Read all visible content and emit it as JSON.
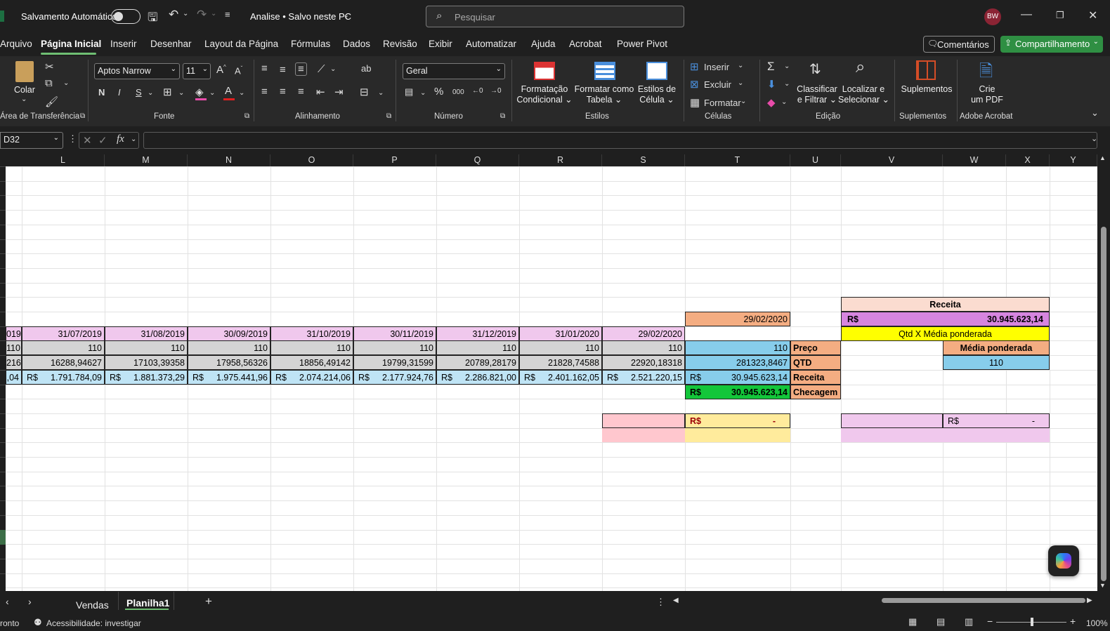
{
  "titlebar": {
    "autosave": "Salvamento Automático",
    "filename": "Analise • Salvo neste PC",
    "search_placeholder": "Pesquisar",
    "avatar": "BW"
  },
  "menu": [
    "Arquivo",
    "Página Inicial",
    "Inserir",
    "Desenhar",
    "Layout da Página",
    "Fórmulas",
    "Dados",
    "Revisão",
    "Exibir",
    "Automatizar",
    "Ajuda",
    "Acrobat",
    "Power Pivot"
  ],
  "buttons": {
    "comments": "Comentários",
    "share": "Compartilhamento"
  },
  "ribbon": {
    "paste": "Colar",
    "clipboard_group": "Área de Transferência",
    "font_name": "Aptos Narrow",
    "font_size": "11",
    "font_group": "Fonte",
    "bold": "N",
    "italic": "I",
    "underline": "S",
    "align_group": "Alinhamento",
    "number_format": "Geral",
    "number_group": "Número",
    "cond_format_1": "Formatação",
    "cond_format_2": "Condicional",
    "format_table_1": "Formatar como",
    "format_table_2": "Tabela",
    "cell_styles_1": "Estilos de",
    "cell_styles_2": "Célula",
    "styles_group": "Estilos",
    "insert": "Inserir",
    "delete": "Excluir",
    "format": "Formatar",
    "cells_group": "Células",
    "sort_1": "Classificar",
    "sort_2": "e Filtrar",
    "find_1": "Localizar e",
    "find_2": "Selecionar",
    "edit_group": "Edição",
    "addins": "Suplementos",
    "addins_group": "Suplementos",
    "pdf_1": "Crie",
    "pdf_2": "um PDF",
    "acrobat_group": "Adobe Acrobat"
  },
  "formula_bar": {
    "name_box": "D32",
    "fx": "fx",
    "value": ""
  },
  "columns": [
    "L",
    "M",
    "N",
    "O",
    "P",
    "Q",
    "R",
    "S",
    "T",
    "U",
    "V",
    "W",
    "X",
    "Y"
  ],
  "cells": {
    "partial": {
      "date": "019",
      "qty": "110",
      "price": "216",
      "revenue": ",04"
    },
    "dates": [
      "31/07/2019",
      "31/08/2019",
      "30/09/2019",
      "31/10/2019",
      "30/11/2019",
      "31/12/2019",
      "31/01/2020",
      "29/02/2020"
    ],
    "qty": [
      "110",
      "110",
      "110",
      "110",
      "110",
      "110",
      "110",
      "110"
    ],
    "prices": [
      "16288,94627",
      "17103,39358",
      "17958,56326",
      "18856,49142",
      "19799,31599",
      "20789,28179",
      "21828,74588",
      "22920,18318"
    ],
    "currency": "R$",
    "revenues": [
      "1.791.784,09",
      "1.881.373,29",
      "1.975.441,96",
      "2.074.214,06",
      "2.177.924,76",
      "2.286.821,00",
      "2.401.162,05",
      "2.521.220,15"
    ],
    "t_date": "29/02/2020",
    "t_price": "110",
    "t_qty": "281323,8467",
    "t_revenue": "30.945.623,14",
    "t_check": "30.945.623,14",
    "u_labels": [
      "Preço",
      "QTD",
      "Receita",
      "Checagem"
    ],
    "receita_header": "Receita",
    "receita_value": "30.945.623,14",
    "qtd_media": "Qtd X Média ponderada",
    "media_header": "Média ponderada",
    "media_value": "110",
    "dash": "-"
  },
  "tabs": [
    "Vendas",
    "Planilha1"
  ],
  "status": {
    "ready": "ronto",
    "accessibility": "Acessibilidade: investigar",
    "zoom": "100%"
  }
}
